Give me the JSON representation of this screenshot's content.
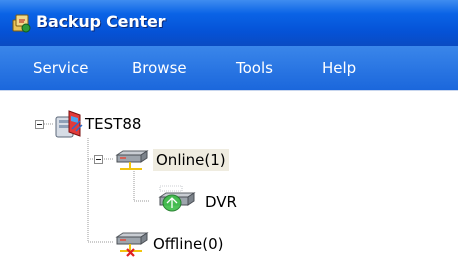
{
  "window": {
    "title": "Backup Center",
    "icon": "backup-center-app-icon"
  },
  "menu": {
    "items": [
      {
        "label": "Service"
      },
      {
        "label": "Browse"
      },
      {
        "label": "Tools"
      },
      {
        "label": "Help"
      }
    ]
  },
  "tree": {
    "root": {
      "label": "TEST88",
      "icon": "computer-server-icon",
      "expanded": true
    },
    "online": {
      "label": "Online(1)",
      "icon": "network-device-icon",
      "expanded": true,
      "selected": true
    },
    "dvr": {
      "label": "DVR",
      "icon": "dvr-device-online-icon"
    },
    "offline": {
      "label": "Offline(0)",
      "icon": "network-device-offline-icon"
    }
  },
  "colors": {
    "titlebar": "#0552d6",
    "menubar": "#1b67dc",
    "selection": "#efece0"
  }
}
